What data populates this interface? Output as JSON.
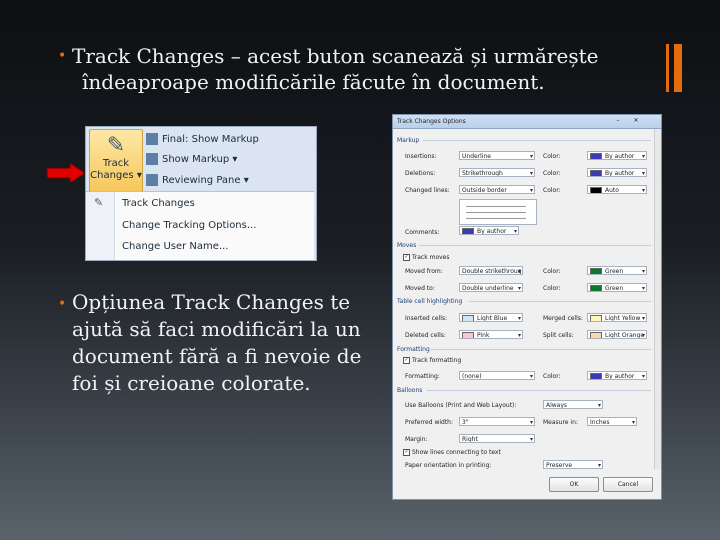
{
  "slide": {
    "bullet1_line1": "Track Changes – acest buton scanează și urmărește",
    "bullet1_line2": "îndeaproape modificările făcute în document.",
    "bullet2_line1": "Opțiunea Track Changes te",
    "bullet2_line2": "ajută să faci modificări la un",
    "bullet2_line3": "document fără a fi nevoie de",
    "bullet2_line4": "foi și creioane colorate.",
    "accent_color": "#e46c0a"
  },
  "ribbon": {
    "track_changes_line1": "Track",
    "track_changes_line2": "Changes ▾",
    "final_show_markup": "Final: Show Markup",
    "show_markup": "Show Markup ▾",
    "reviewing_pane": "Reviewing Pane ▾",
    "menu": [
      "Track Changes",
      "Change Tracking Options...",
      "Change User Name..."
    ]
  },
  "dialog": {
    "title": "Track Changes Options",
    "markup_section": "Markup",
    "insertions_label": "Insertions:",
    "insertions_value": "Underline",
    "deletions_label": "Deletions:",
    "deletions_value": "Strikethrough",
    "changed_lines_label": "Changed lines:",
    "changed_lines_value": "Outside border",
    "comments_label": "Comments:",
    "comments_value": "By author",
    "color_label": "Color:",
    "color_by_author": "By author",
    "color_auto": "Auto",
    "moves_section": "Moves",
    "track_moves": "Track moves",
    "moved_from_label": "Moved from:",
    "moved_from_value": "Double strikethrough",
    "moved_to_label": "Moved to:",
    "moved_to_value": "Double underline",
    "green": "Green",
    "table_section": "Table cell highlighting",
    "inserted_cells_label": "Inserted cells:",
    "inserted_cells_value": "Light Blue",
    "merged_cells_label": "Merged cells:",
    "merged_cells_value": "Light Yellow",
    "deleted_cells_label": "Deleted cells:",
    "deleted_cells_value": "Pink",
    "split_cells_label": "Split cells:",
    "split_cells_value": "Light Orange",
    "formatting_section": "Formatting",
    "track_formatting": "Track formatting",
    "formatting_label": "Formatting:",
    "formatting_value": "(none)",
    "balloons_section": "Balloons",
    "use_balloons_label": "Use Balloons (Print and Web Layout):",
    "use_balloons_value": "Always",
    "preferred_width_label": "Preferred width:",
    "preferred_width_value": "3\"",
    "measure_in_label": "Measure in:",
    "measure_in_value": "Inches",
    "margin_label": "Margin:",
    "margin_value": "Right",
    "show_lines": "Show lines connecting to text",
    "paper_orientation_label": "Paper orientation in printing:",
    "paper_orientation_value": "Preserve",
    "ok": "OK",
    "cancel": "Cancel",
    "swatch_colors": {
      "by_author": "#3b3bb8",
      "auto": "#000000",
      "green": "#0a7a2a",
      "light_blue": "#cfe6f7",
      "light_yellow": "#fff7c0",
      "pink": "#f7c7d7",
      "light_orange": "#fbd9b0"
    }
  }
}
